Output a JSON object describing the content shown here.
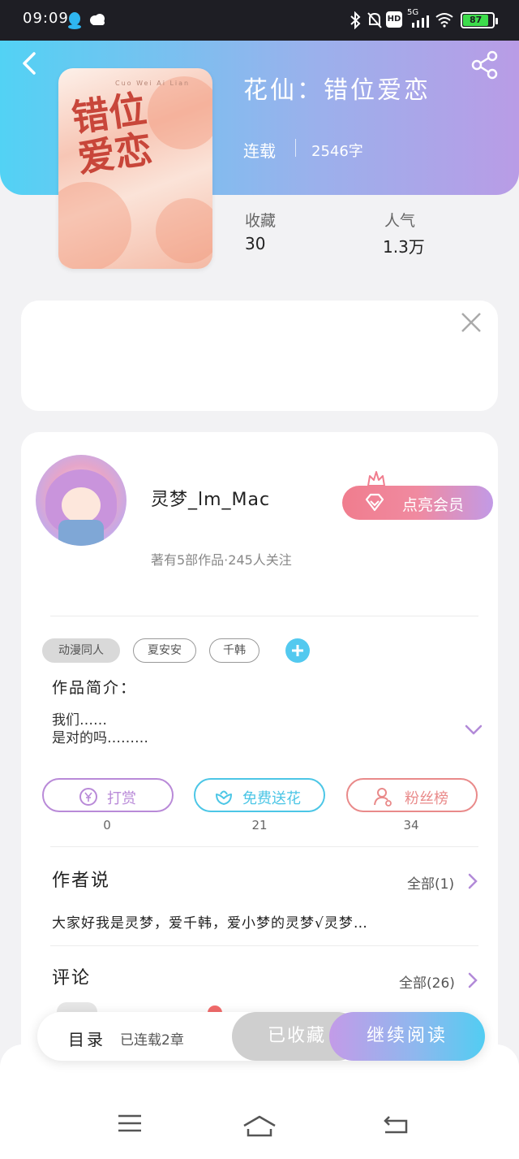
{
  "status_bar": {
    "time": "09:09",
    "battery": "87",
    "network": "5G",
    "hd_badge": "HD",
    "icons": [
      "qq-icon",
      "weather-cloud-icon",
      "bluetooth-icon",
      "mute-bell-icon",
      "hd-icon",
      "signal-icon",
      "wifi-icon",
      "battery-icon"
    ]
  },
  "book": {
    "title": "花仙：错位爱恋",
    "status": "连载",
    "word_count": "2546字",
    "cover": {
      "title": "错位爱恋",
      "subtitle": "Cuo Wei Ai Lian"
    },
    "stats": {
      "favorites_label": "收藏",
      "favorites_value": "30",
      "popularity_label": "人气",
      "popularity_value": "1.3万"
    }
  },
  "author": {
    "name": "灵梦_lm_Mac",
    "meta": "著有5部作品·245人关注",
    "vip_button": "点亮会员"
  },
  "tags": [
    "动漫同人",
    "夏安安",
    "千韩"
  ],
  "intro": {
    "label": "作品简介：",
    "lines": [
      "我们……",
      "是对的吗………"
    ]
  },
  "actions": [
    {
      "label": "打赏",
      "count": "0",
      "icon": "yuan-coin-icon",
      "color": "#b98ad8"
    },
    {
      "label": "免费送花",
      "count": "21",
      "icon": "flower-icon",
      "color": "#4cc6e6"
    },
    {
      "label": "粉丝榜",
      "count": "34",
      "icon": "user-icon",
      "color": "#e98a8a"
    }
  ],
  "author_says": {
    "title": "作者说",
    "all_label": "全部(1)",
    "text": "大家好我是灵梦，爱千韩，爱小梦的灵梦√灵梦…"
  },
  "comments": {
    "title": "评论",
    "all_label": "全部(26)"
  },
  "bottom_bar": {
    "toc_label": "目录",
    "chapters_text": "已连载2章",
    "collected_label": "已收藏",
    "read_label": "继续阅读"
  },
  "colors": {
    "header_start": "#52d2f4",
    "header_end": "#b99ce6",
    "accent_blue": "#53c9ef"
  }
}
